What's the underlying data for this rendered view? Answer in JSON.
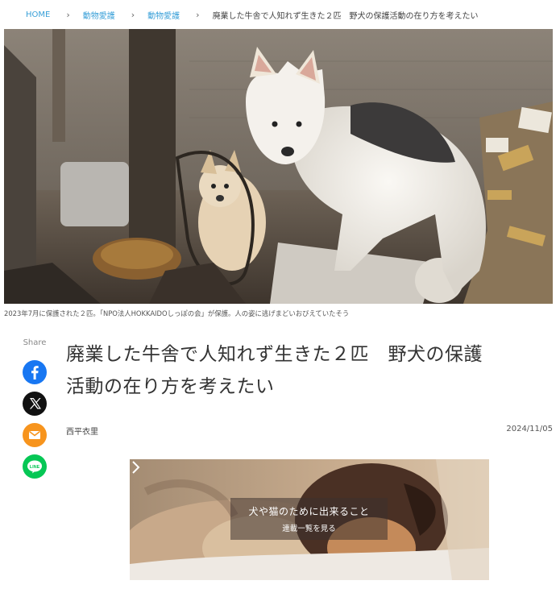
{
  "breadcrumb": {
    "items": [
      "HOME",
      "動物愛護",
      "動物愛護"
    ],
    "current": "廃業した牛舎で人知れず生きた２匹　野犬の保護活動の在り方を考えたい"
  },
  "hero": {
    "caption": "2023年7月に保護された２匹。「NPO法人HOKKAIDOしっぽの会」が保護。人の姿に逃げまどいおびえていたそう"
  },
  "share": {
    "label": "Share",
    "buttons": [
      {
        "service": "facebook",
        "icon": "facebook-icon",
        "color": "#1877f2"
      },
      {
        "service": "x",
        "icon": "x-icon",
        "color": "#111111"
      },
      {
        "service": "mail",
        "icon": "mail-icon",
        "color": "#f7941d"
      },
      {
        "service": "line",
        "icon": "line-icon",
        "color": "#06c755"
      }
    ]
  },
  "article": {
    "title_line1": "廃業した牛舎で人知れず生きた２匹　野犬の保護",
    "title_line2": "活動の在り方を考えたい",
    "author": "西平衣里",
    "date": "2024/11/05"
  },
  "banner": {
    "title": "犬や猫のために出来ること",
    "subtitle": "連載一覧を見る",
    "icon": "chevron-right-icon"
  },
  "colors": {
    "link": "#3aa0d8",
    "text": "#333333"
  }
}
